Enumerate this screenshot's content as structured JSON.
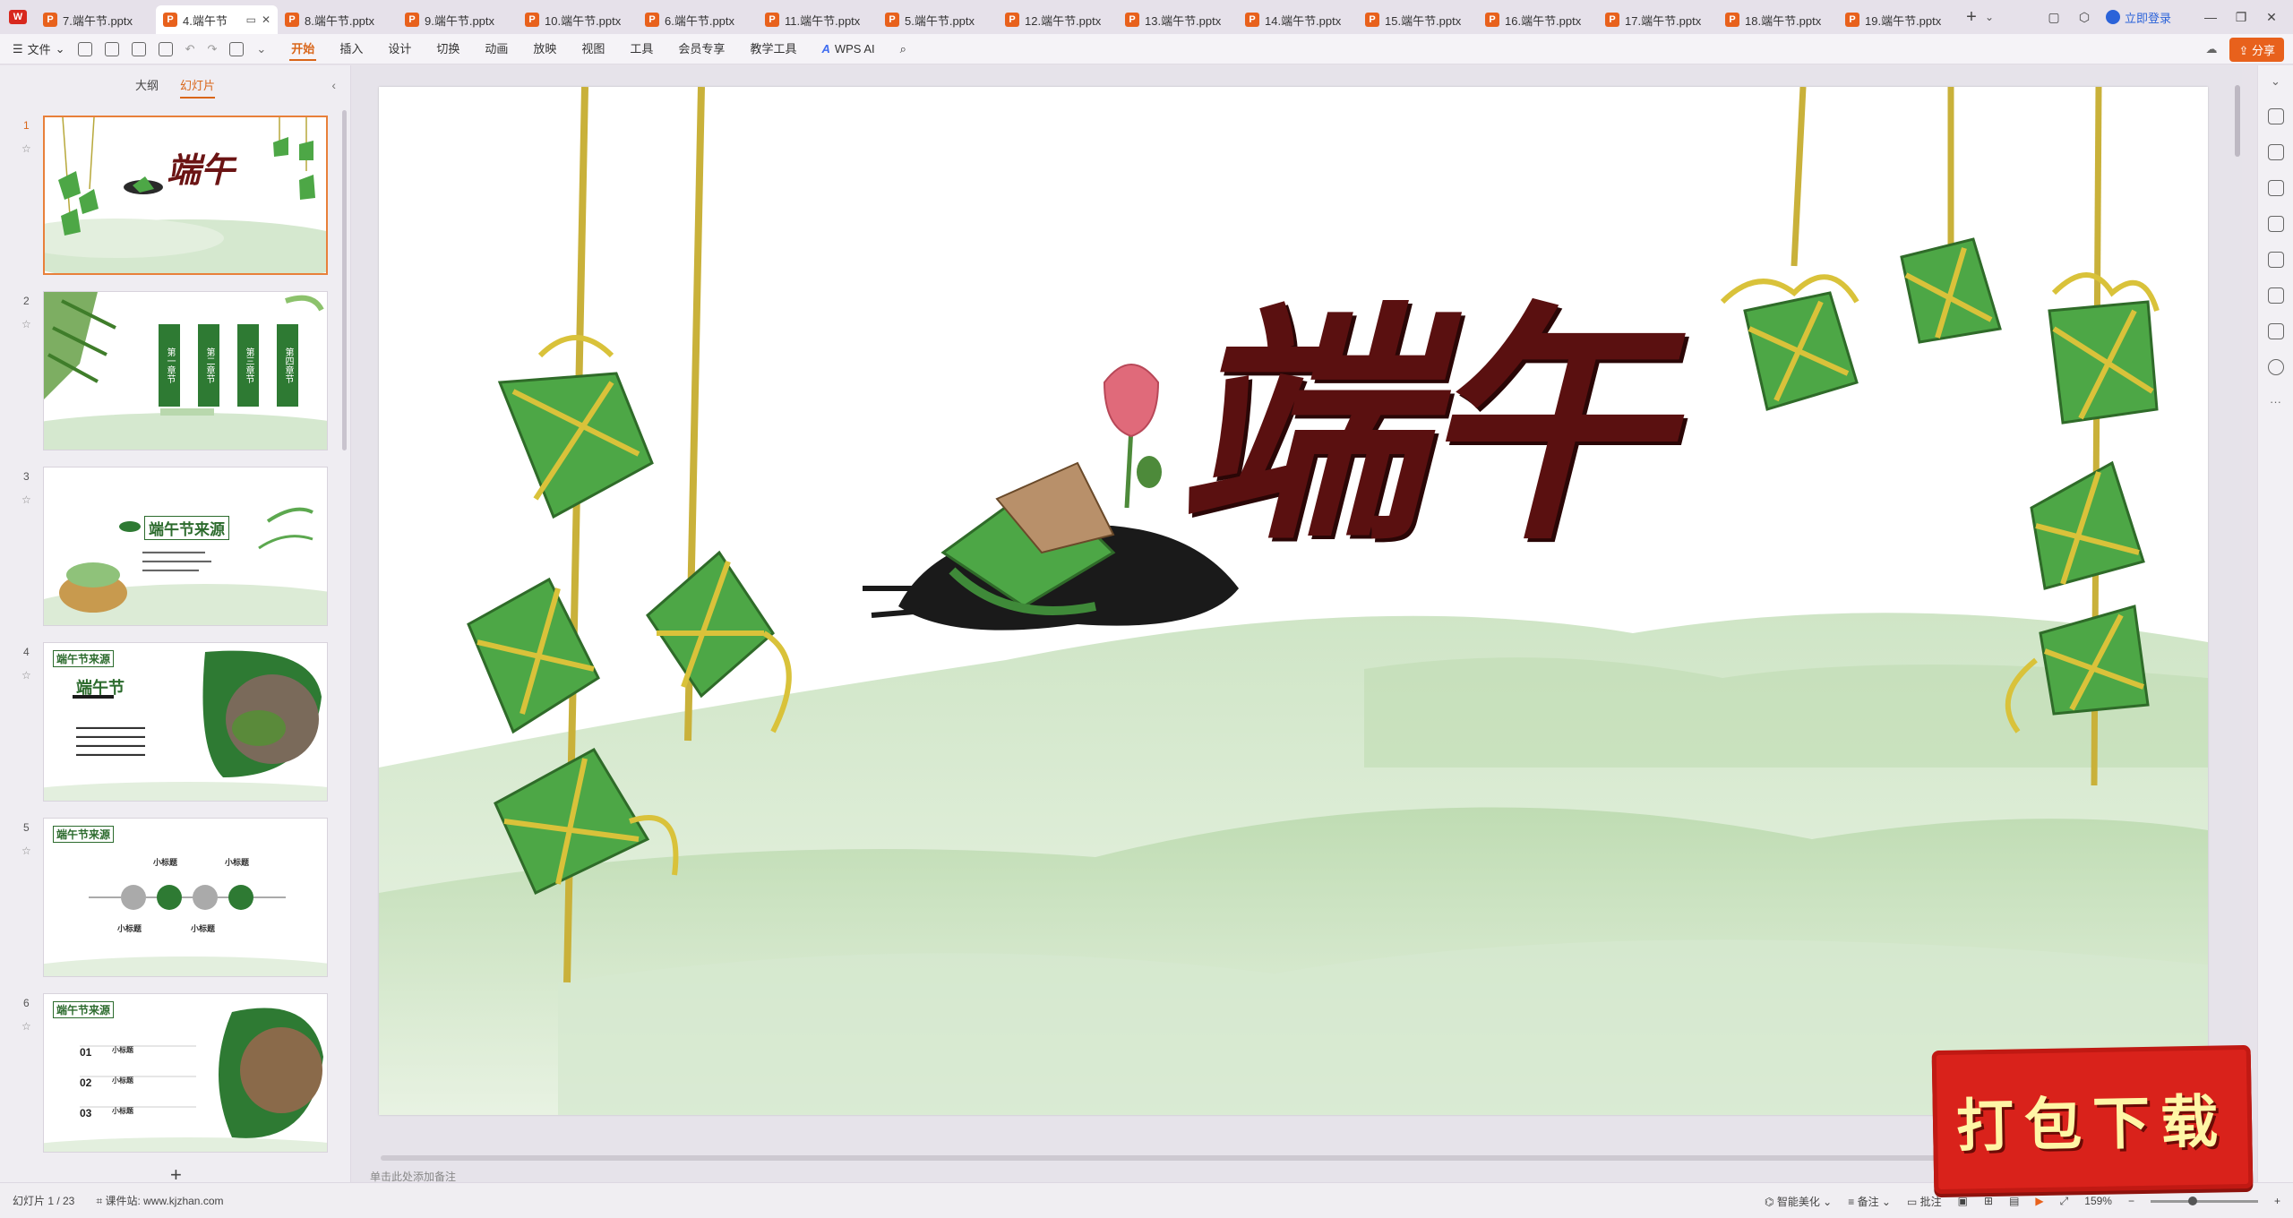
{
  "app": {
    "logo": "W"
  },
  "tabs": [
    {
      "label": "7.端午节.pptx"
    },
    {
      "label": "4.端午节",
      "active": true
    },
    {
      "label": "8.端午节.pptx"
    },
    {
      "label": "9.端午节.pptx"
    },
    {
      "label": "10.端午节.pptx"
    },
    {
      "label": "6.端午节.pptx"
    },
    {
      "label": "11.端午节.pptx"
    },
    {
      "label": "5.端午节.pptx"
    },
    {
      "label": "12.端午节.pptx"
    },
    {
      "label": "13.端午节.pptx"
    },
    {
      "label": "14.端午节.pptx"
    },
    {
      "label": "15.端午节.pptx"
    },
    {
      "label": "16.端午节.pptx"
    },
    {
      "label": "17.端午节.pptx"
    },
    {
      "label": "18.端午节.pptx"
    },
    {
      "label": "19.端午节.pptx"
    }
  ],
  "tabbar": {
    "add": "+",
    "login": "立即登录"
  },
  "menu": {
    "file": "文件",
    "tabs": [
      "开始",
      "插入",
      "设计",
      "切换",
      "动画",
      "放映",
      "视图",
      "工具",
      "会员专享",
      "教学工具"
    ],
    "active": "开始",
    "wps_ai": "WPS AI",
    "share": "分享"
  },
  "panel": {
    "tab_outline": "大纲",
    "tab_slides": "幻灯片",
    "add": "+"
  },
  "thumbs": {
    "t1": "端午",
    "t2": [
      "第一章节",
      "第二章节",
      "第三章节",
      "第四章节"
    ],
    "t3": "端午节来源",
    "t4_header": "端午节来源",
    "t4_title": "端午节",
    "t5_header": "端午节来源",
    "t5_labels": [
      "小标题",
      "小标题",
      "小标题",
      "小标题"
    ],
    "t6_header": "端午节来源",
    "t6_items": [
      {
        "num": "01",
        "label": "小标题"
      },
      {
        "num": "02",
        "label": "小标题"
      },
      {
        "num": "03",
        "label": "小标题"
      }
    ]
  },
  "slide": {
    "title": "端午"
  },
  "notes_hint": "单击此处添加备注",
  "status": {
    "slide_count": "幻灯片 1 / 23",
    "site": "课件站: www.kjzhan.com",
    "beautify": "智能美化",
    "notes": "备注",
    "comments": "批注",
    "zoom": "159%"
  },
  "badge": {
    "text": "打包下载"
  },
  "colors": {
    "accent": "#d9661a",
    "leaf_green": "#3f9a3c",
    "title_red": "#6b1414",
    "badge_red": "#d9221b"
  }
}
